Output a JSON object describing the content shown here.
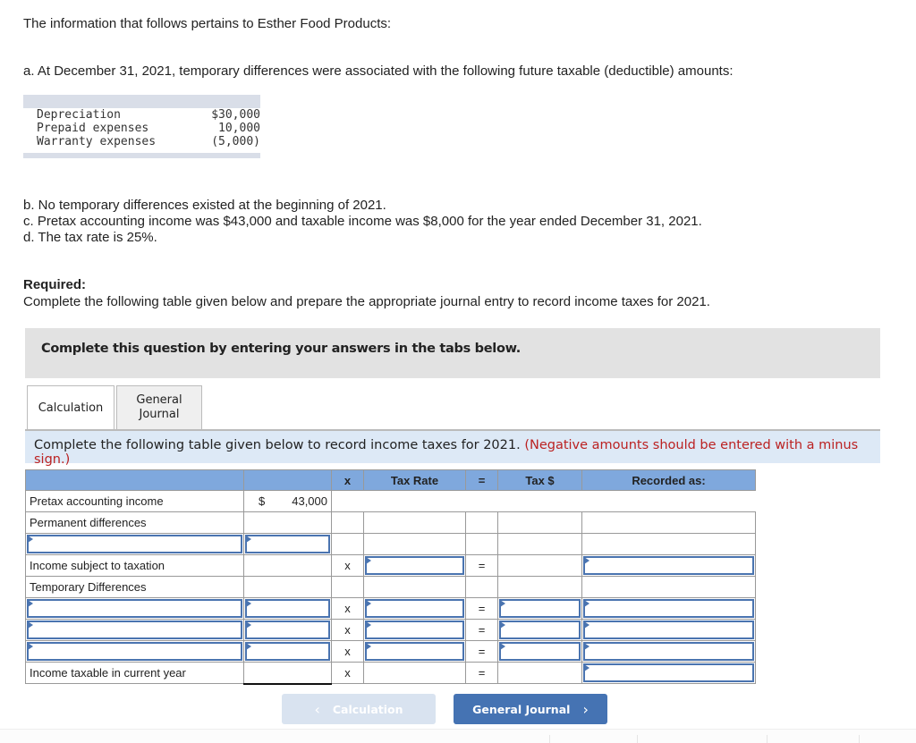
{
  "intro": "The information that follows pertains to Esther Food Products:",
  "item_a": "a. At December 31, 2021, temporary differences were associated with the following future taxable (deductible) amounts:",
  "temp_diff_table": [
    {
      "label": "Depreciation",
      "value": "$30,000"
    },
    {
      "label": "Prepaid expenses",
      "value": " 10,000"
    },
    {
      "label": "Warranty expenses",
      "value": "(5,000)"
    }
  ],
  "facts": [
    "b. No temporary differences existed at the beginning of 2021.",
    "c. Pretax accounting income was $43,000 and taxable income was $8,000 for the year ended December 31, 2021.",
    "d. The tax rate is 25%."
  ],
  "required": {
    "heading": "Required:",
    "text": "Complete the following table given below and prepare the appropriate journal entry to record income taxes for 2021."
  },
  "banner": "Complete this question by entering your answers in the tabs below.",
  "tabs": [
    {
      "label": "Calculation",
      "active": true
    },
    {
      "label": "General Journal",
      "active": false
    }
  ],
  "instruction": {
    "text": "Complete the following table given below to record income taxes for 2021. ",
    "note": "(Negative amounts should be entered with a minus sign.)"
  },
  "table": {
    "headers": [
      "",
      "",
      "x",
      "Tax Rate",
      "=",
      "Tax $",
      "Recorded as:"
    ],
    "pretax_label": "Pretax accounting income",
    "pretax_currency": "$",
    "pretax_amount": "43,000",
    "permanent_label": "Permanent differences",
    "income_subject_label": "Income subject to taxation",
    "temporary_label": "Temporary Differences",
    "income_taxable_label": "Income taxable in current year",
    "times_symbol": "x",
    "equals_symbol": "="
  },
  "nav": {
    "prev_label": "Calculation",
    "next_label": "General Journal",
    "prev_icon": "‹",
    "next_icon": "›"
  }
}
